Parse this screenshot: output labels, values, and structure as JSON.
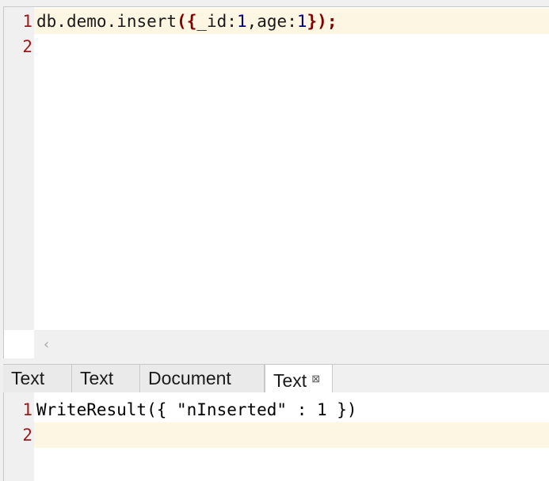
{
  "editor": {
    "line_numbers": [
      "1",
      "2"
    ],
    "line1_tokens": {
      "db": "db",
      "dot1": ".",
      "demo": "demo",
      "dot2": ".",
      "insert": "insert",
      "paren_open": "(",
      "brace_open": "{",
      "key1": "_id",
      "colon1": ":",
      "val1": "1",
      "comma": ",",
      "key2": "age",
      "colon2": ":",
      "val2": "1",
      "brace_close": "}",
      "paren_close": ")",
      "semicolon": ";"
    },
    "scroll_left_glyph": "‹"
  },
  "result_tabs": {
    "tabs": [
      {
        "label": "Text"
      },
      {
        "label": "Text"
      },
      {
        "label": "Document"
      },
      {
        "label": "Text",
        "close": "⊠"
      }
    ]
  },
  "output": {
    "line_numbers": [
      "1",
      "2"
    ],
    "line1": "WriteResult({ \"nInserted\" : 1 })"
  },
  "colors": {
    "current_line": "#fdf6e3",
    "line_number": "#9a1a1a",
    "keyword_brace": "#800000",
    "number": "#000080"
  }
}
